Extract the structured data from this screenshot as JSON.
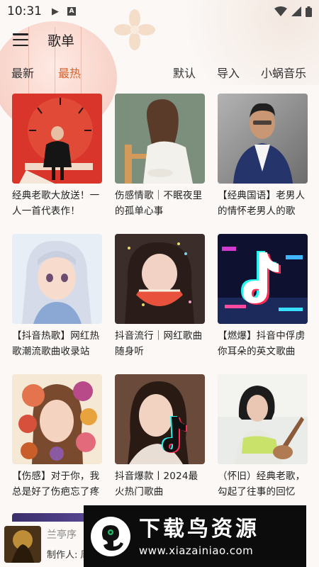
{
  "status_bar": {
    "time": "10:31",
    "icons": [
      "play-icon",
      "a-notification-icon",
      "wifi-icon",
      "signal-icon",
      "battery-icon"
    ]
  },
  "app_bar": {
    "title": "歌单",
    "menu_icon": "hamburger-menu-icon"
  },
  "tabs": {
    "latest": "最新",
    "hot": "最热",
    "default": "默认",
    "import": "导入",
    "snail_music": "小蜗音乐",
    "active": "hot",
    "accent_color": "#d8612d"
  },
  "playlists": [
    {
      "title": "经典老歌大放送！一人一首代表作！"
    },
    {
      "title": "伤感情歌｜不眠夜里的孤单心事"
    },
    {
      "title": "【经典国语】老男人的情怀老男人的歌"
    },
    {
      "title": "【抖音热歌】网红热歌潮流歌曲收录站"
    },
    {
      "title": "抖音流行｜网红歌曲随身听"
    },
    {
      "title": "【燃爆】抖音中俘虏你耳朵的英文歌曲"
    },
    {
      "title": "【伤感】对于你，我总是好了伤疤忘了疼"
    },
    {
      "title": "抖音爆款丨2024最火热门歌曲"
    },
    {
      "title": "（怀旧）经典老歌，勾起了往事的回忆"
    }
  ],
  "player": {
    "song": "兰亭序",
    "creator": "制作人: 周"
  },
  "watermark": {
    "title": "下载鸟资源",
    "url": "www.xiazainiao.com"
  }
}
